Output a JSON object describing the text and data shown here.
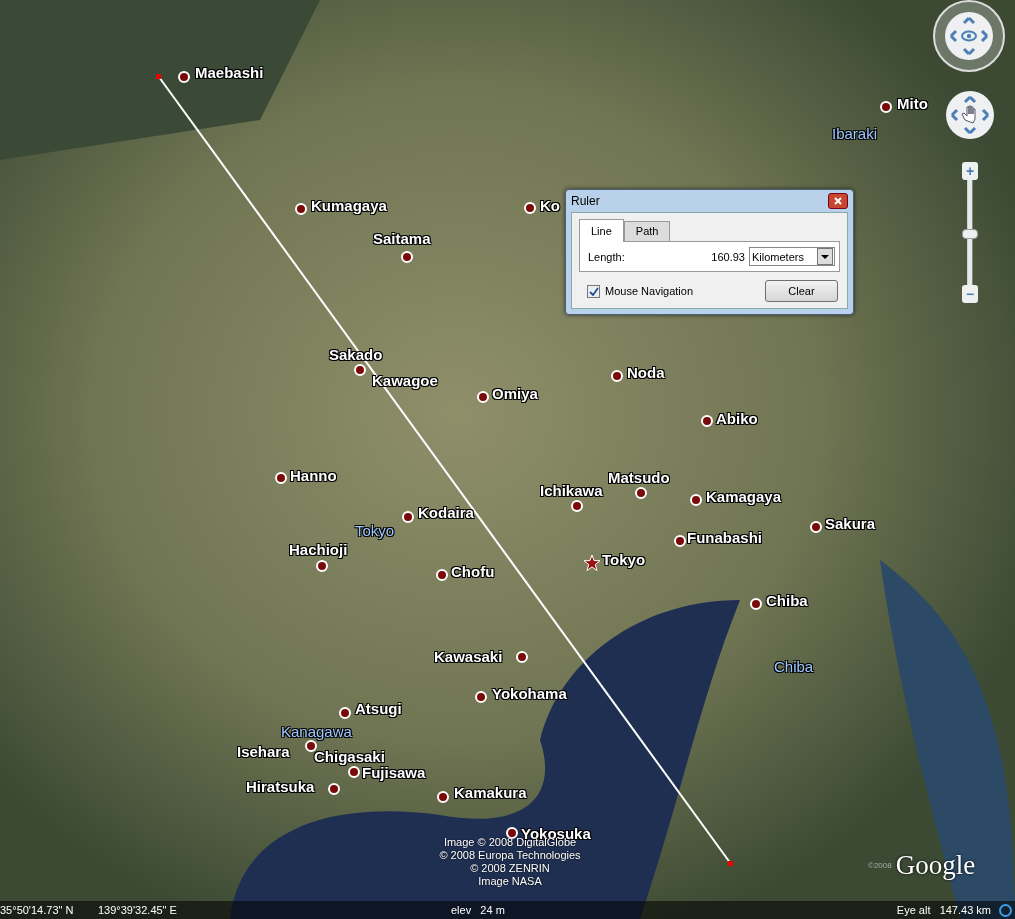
{
  "places": [
    {
      "name": "Maebashi",
      "kind": "city"
    },
    {
      "name": "Mito",
      "kind": "city"
    },
    {
      "name": "Ibaraki",
      "kind": "prefecture"
    },
    {
      "name": "Ko",
      "kind": "city"
    },
    {
      "name": "Kumagaya",
      "kind": "city"
    },
    {
      "name": "Saitama",
      "kind": "city"
    },
    {
      "name": "Sakado",
      "kind": "city"
    },
    {
      "name": "Kawagoe",
      "kind": "city"
    },
    {
      "name": "Omiya",
      "kind": "city"
    },
    {
      "name": "Noda",
      "kind": "city"
    },
    {
      "name": "Abiko",
      "kind": "city"
    },
    {
      "name": "Hanno",
      "kind": "city"
    },
    {
      "name": "Matsudo",
      "kind": "city"
    },
    {
      "name": "Ichikawa",
      "kind": "city"
    },
    {
      "name": "Kamagaya",
      "kind": "city"
    },
    {
      "name": "Kodaira",
      "kind": "city"
    },
    {
      "name": "Tokyo",
      "kind": "prefecture"
    },
    {
      "name": "Sakura",
      "kind": "city"
    },
    {
      "name": "Funabashi",
      "kind": "city"
    },
    {
      "name": "Hachioji",
      "kind": "city"
    },
    {
      "name": "Tokyo",
      "kind": "capital"
    },
    {
      "name": "Chofu",
      "kind": "city"
    },
    {
      "name": "Chiba",
      "kind": "city"
    },
    {
      "name": "Chiba",
      "kind": "prefecture"
    },
    {
      "name": "Kawasaki",
      "kind": "city"
    },
    {
      "name": "Yokohama",
      "kind": "city"
    },
    {
      "name": "Atsugi",
      "kind": "city"
    },
    {
      "name": "Kanagawa",
      "kind": "prefecture"
    },
    {
      "name": "Isehara",
      "kind": "city"
    },
    {
      "name": "Chigasaki",
      "kind": "city"
    },
    {
      "name": "Fujisawa",
      "kind": "city"
    },
    {
      "name": "Hiratsuka",
      "kind": "city"
    },
    {
      "name": "Kamakura",
      "kind": "city"
    },
    {
      "name": "Yokosuka",
      "kind": "city"
    }
  ],
  "attribution": [
    "Image © 2008 DigitalGlobe",
    "© 2008 Europa Technologies",
    "© 2008 ZENRIN",
    "Image NASA"
  ],
  "logo": {
    "text": "Google",
    "year": "©2008"
  },
  "zoom_slider": {
    "zoom_in": "+",
    "zoom_out": "−",
    "level": 0.5
  },
  "ruler": {
    "title": "Ruler",
    "tabs": [
      {
        "label": "Line",
        "selected": true
      },
      {
        "label": "Path",
        "selected": false
      }
    ],
    "length_label": "Length:",
    "length_value": "160.93",
    "unit": "Kilometers",
    "mouse_navigation": {
      "label": "Mouse Navigation",
      "checked": true
    },
    "clear_button": "Clear"
  },
  "status_bar": {
    "latitude": "35°50'14.73\" N",
    "longitude": "139°39'32.45\" E",
    "elevation": "elev   24 m",
    "eye_altitude": "Eye alt   147.43 km"
  }
}
